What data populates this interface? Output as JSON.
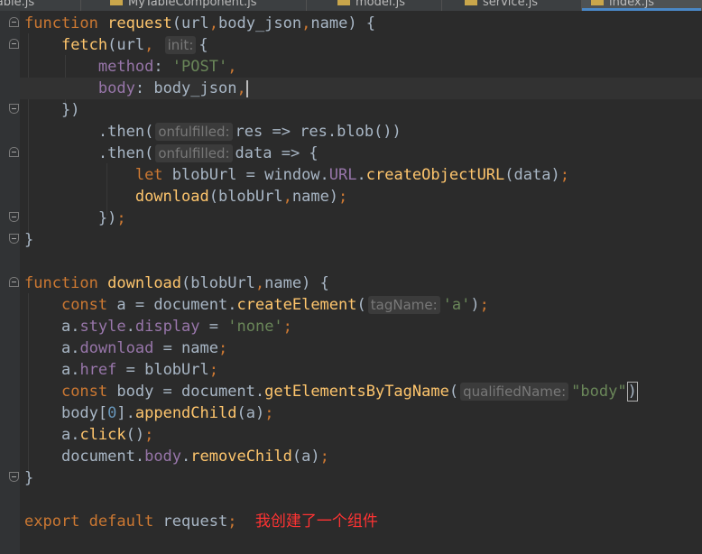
{
  "tabs": [
    {
      "label": "Table.js",
      "active": false
    },
    {
      "label": "MyTableComponent.js",
      "active": false
    },
    {
      "label": "model.js",
      "active": false
    },
    {
      "label": "service.js",
      "active": false
    },
    {
      "label": "index.js",
      "active": true
    }
  ],
  "code": {
    "l1": {
      "kw": "function",
      "fn": "request",
      "params": "(url",
      "c1": ",",
      "p2": "body_json",
      "c2": ",",
      "p3": "name) {"
    },
    "l2": {
      "fn": "fetch",
      "a": "(url",
      "c": ",",
      "hint": "init:",
      "b": "{"
    },
    "l3": {
      "prop": "method",
      "colon": ": ",
      "str": "'POST'",
      "c": ","
    },
    "l4": {
      "prop": "body",
      "colon": ": ",
      "val": "body_json",
      "c": ","
    },
    "l5": {
      "text": "})"
    },
    "l6": {
      "a": ".then(",
      "hint": "onfulfilled:",
      "b": "res => res.blob())"
    },
    "l7": {
      "a": ".then(",
      "hint": "onfulfilled:",
      "b": "data => {"
    },
    "l8": {
      "kw": "let",
      "a": " blobUrl = window.",
      "prop": "URL",
      "b": ".",
      "fn": "createObjectURL",
      "c": "(data)",
      "semi": ";"
    },
    "l9": {
      "fn": "download",
      "a": "(blobUrl",
      "c": ",",
      "b": "name)",
      "semi": ";"
    },
    "l10": {
      "a": "})",
      "semi": ";"
    },
    "l11": {
      "text": "}"
    },
    "l13": {
      "kw": "function",
      "fn": "download",
      "a": "(blobUrl",
      "c": ",",
      "b": "name) {"
    },
    "l14": {
      "kw": "const",
      "a": " a = document.",
      "fn": "createElement",
      "b": "(",
      "hint": "tagName:",
      "str": "'a'",
      "c": ")",
      "semi": ";"
    },
    "l15": {
      "a": "a.",
      "prop1": "style",
      "dot": ".",
      "prop2": "display",
      "b": " = ",
      "str": "'none'",
      "semi": ";"
    },
    "l16": {
      "a": "a.",
      "prop": "download",
      "b": " = name",
      "semi": ";"
    },
    "l17": {
      "a": "a.",
      "prop": "href",
      "b": " = blobUrl",
      "semi": ";"
    },
    "l18": {
      "kw": "const",
      "a": " body = document.",
      "fn": "getElementsByTagName",
      "b": "(",
      "hint": "qualifiedName:",
      "str": "\"body\"",
      "c": ")"
    },
    "l19": {
      "a": "body[",
      "num": "0",
      "b": "].",
      "fn": "appendChild",
      "c": "(a)",
      "semi": ";"
    },
    "l20": {
      "a": "a.",
      "fn": "click",
      "b": "()",
      "semi": ";"
    },
    "l21": {
      "a": "document.",
      "prop": "body",
      "b": ".",
      "fn": "removeChild",
      "c": "(a)",
      "semi": ";"
    },
    "l22": {
      "text": "}"
    },
    "l24": {
      "kw": "export default",
      "a": " request",
      "semi": ";",
      "note": "我创建了一个组件"
    }
  },
  "colors": {
    "background": "#2b2b2b",
    "keyword": "#cc7832",
    "function": "#ffc66d",
    "property": "#9876aa",
    "string": "#6a8759",
    "number": "#6897bb",
    "text": "#a9b7c6",
    "annotation": "#ff3333"
  }
}
